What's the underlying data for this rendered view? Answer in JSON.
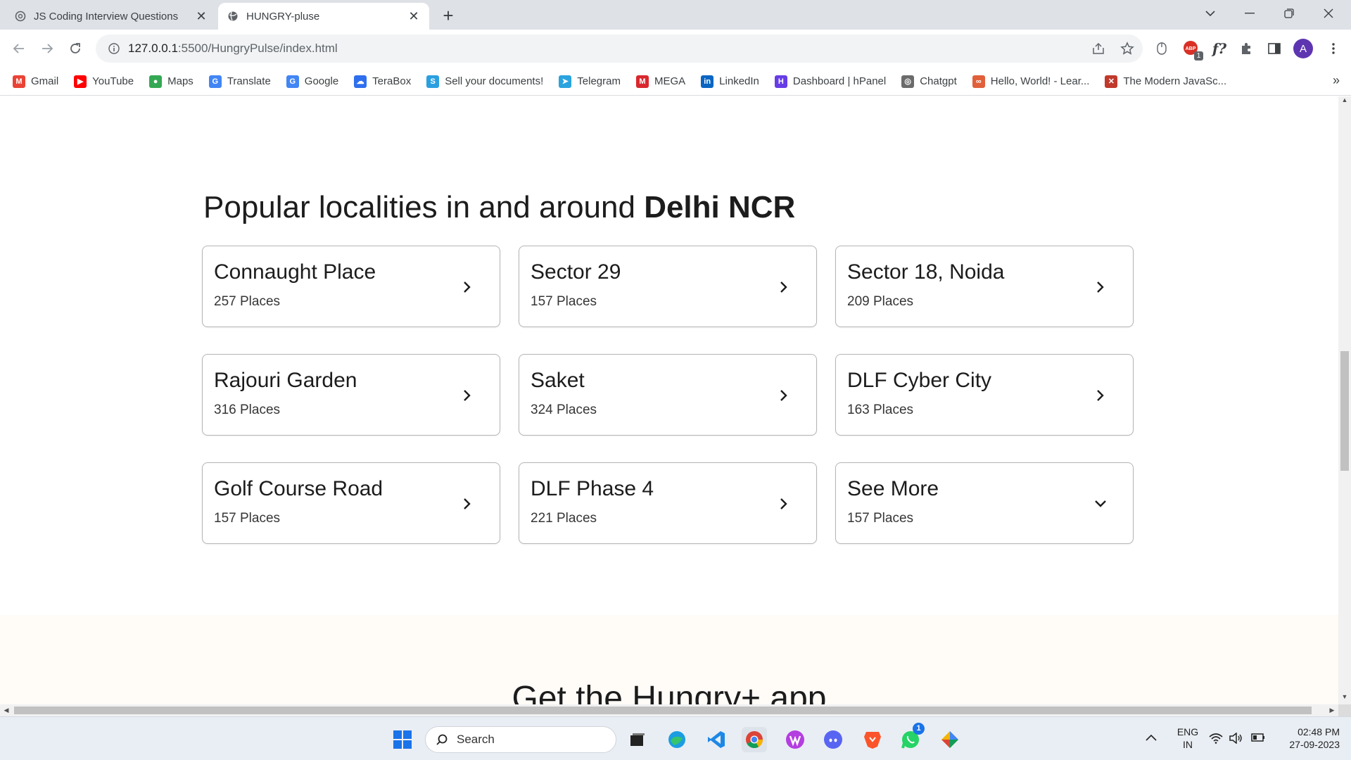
{
  "browser": {
    "tabs": [
      {
        "title": "JS Coding Interview Questions",
        "icon": "chatgpt-icon"
      },
      {
        "title": "HUNGRY-pluse",
        "icon": "globe-icon"
      }
    ],
    "url_host": "127.0.0.1",
    "url_path": ":5500/HungryPulse/index.html",
    "profile_initial": "A",
    "extension_badge": "1",
    "formula_ext": "f?"
  },
  "bookmarks": [
    {
      "label": "Gmail",
      "icon": "gmail-icon",
      "color": "#ea4335",
      "glyph": "M"
    },
    {
      "label": "YouTube",
      "icon": "youtube-icon",
      "color": "#ff0000",
      "glyph": "▶"
    },
    {
      "label": "Maps",
      "icon": "maps-icon",
      "color": "#34a853",
      "glyph": "●"
    },
    {
      "label": "Translate",
      "icon": "translate-icon",
      "color": "#4285f4",
      "glyph": "G"
    },
    {
      "label": "Google",
      "icon": "google-icon",
      "color": "#4285f4",
      "glyph": "G"
    },
    {
      "label": "TeraBox",
      "icon": "terabox-icon",
      "color": "#2f6fed",
      "glyph": "☁"
    },
    {
      "label": "Sell your documents!",
      "icon": "stuvia-icon",
      "color": "#2aa0e0",
      "glyph": "S"
    },
    {
      "label": "Telegram",
      "icon": "telegram-icon",
      "color": "#2aa3df",
      "glyph": "➤"
    },
    {
      "label": "MEGA",
      "icon": "mega-icon",
      "color": "#d9272e",
      "glyph": "M"
    },
    {
      "label": "LinkedIn",
      "icon": "linkedin-icon",
      "color": "#0a66c2",
      "glyph": "in"
    },
    {
      "label": "Dashboard | hPanel",
      "icon": "hostinger-icon",
      "color": "#673de6",
      "glyph": "H"
    },
    {
      "label": "Chatgpt",
      "icon": "chatgpt-icon",
      "color": "#6b6b6b",
      "glyph": "◎"
    },
    {
      "label": "Hello, World! - Lear...",
      "icon": "codecademy-icon",
      "color": "#e0603a",
      "glyph": "∞"
    },
    {
      "label": "The Modern JavaSc...",
      "icon": "javascript-info-icon",
      "color": "#c0392b",
      "glyph": "✕"
    }
  ],
  "page": {
    "heading_prefix": "Popular localities in and around ",
    "heading_city": "Delhi NCR",
    "localities": [
      {
        "name": "Connaught Place",
        "places": "257 Places",
        "icon": "chevron-right-icon"
      },
      {
        "name": "Sector 29",
        "places": "157 Places",
        "icon": "chevron-right-icon"
      },
      {
        "name": "Sector 18, Noida",
        "places": "209 Places",
        "icon": "chevron-right-icon"
      },
      {
        "name": "Rajouri Garden",
        "places": "316 Places",
        "icon": "chevron-right-icon"
      },
      {
        "name": "Saket",
        "places": "324 Places",
        "icon": "chevron-right-icon"
      },
      {
        "name": "DLF Cyber City",
        "places": "163 Places",
        "icon": "chevron-right-icon"
      },
      {
        "name": "Golf Course Road",
        "places": "157 Places",
        "icon": "chevron-right-icon"
      },
      {
        "name": "DLF Phase 4",
        "places": "221 Places",
        "icon": "chevron-right-icon"
      },
      {
        "name": "See More",
        "places": "157 Places",
        "icon": "chevron-down-icon"
      }
    ],
    "app_heading": "Get the Hungry+ app"
  },
  "taskbar": {
    "search_placeholder": "Search",
    "language": "ENG",
    "region": "IN",
    "time": "02:48 PM",
    "date": "27-09-2023",
    "whatsapp_badge": "1"
  }
}
